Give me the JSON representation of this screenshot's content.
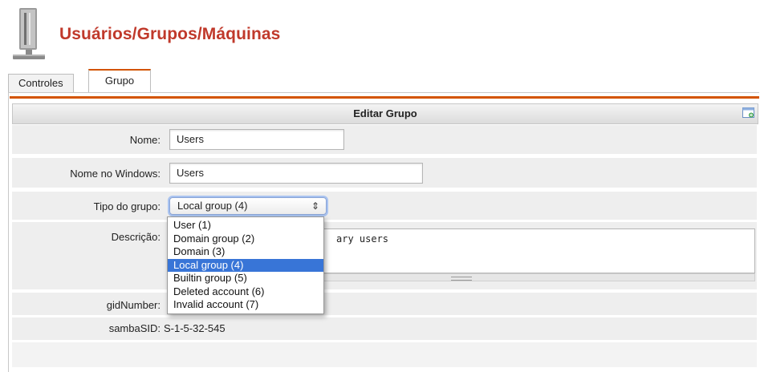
{
  "page": {
    "title": "Usuários/Grupos/Máquinas"
  },
  "tabs": [
    {
      "label": "Controles"
    },
    {
      "label": "Grupo"
    }
  ],
  "form": {
    "header": "Editar Grupo",
    "fields": {
      "nome": {
        "label": "Nome:",
        "value": "Users"
      },
      "nome_windows": {
        "label": "Nome no Windows:",
        "value": "Users"
      },
      "tipo_grupo": {
        "label": "Tipo do grupo:",
        "value": "Local group (4)"
      },
      "descricao": {
        "label": "Descrição:",
        "value": "ary users"
      },
      "gid": {
        "label": "gidNumber:",
        "value": ""
      },
      "samba_sid": {
        "label": "sambaSID:",
        "value": "S-1-5-32-545"
      }
    },
    "tipo_options": [
      "User (1)",
      "Domain group (2)",
      "Domain (3)",
      "Local group (4)",
      "Builtin group (5)",
      "Deleted account (6)",
      "Invalid account (7)"
    ],
    "selected_index": 3
  },
  "colors": {
    "accent": "#d35400",
    "title": "#c0392b",
    "selection": "#3875d7"
  }
}
